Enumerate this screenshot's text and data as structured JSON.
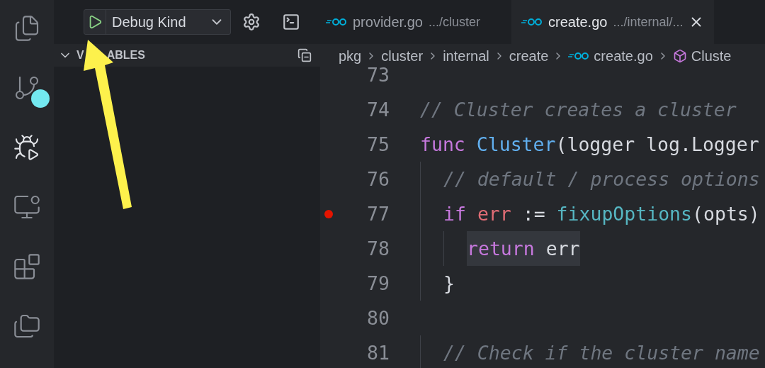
{
  "activity_bar": [
    {
      "kind": "explorer",
      "selected": false,
      "badge": false
    },
    {
      "kind": "source_control",
      "selected": false,
      "badge": true
    },
    {
      "kind": "run_debug",
      "selected": true,
      "badge": false
    },
    {
      "kind": "remote",
      "selected": false,
      "badge": false
    },
    {
      "kind": "extensions",
      "selected": false,
      "badge": false
    },
    {
      "kind": "folders",
      "selected": false,
      "badge": false
    }
  ],
  "debug_toolbar": {
    "configuration": "Debug Kind"
  },
  "tabs": [
    {
      "label": "provider.go",
      "description": ".../cluster",
      "selected": false
    },
    {
      "label": "create.go",
      "description": ".../internal/...",
      "selected": true
    }
  ],
  "sidebar": {
    "section_title": [
      "V",
      "ABLES"
    ],
    "expanded": true
  },
  "breadcrumbs": [
    {
      "text": "pkg",
      "kind": "folder"
    },
    {
      "text": "cluster",
      "kind": "folder"
    },
    {
      "text": "internal",
      "kind": "folder"
    },
    {
      "text": "create",
      "kind": "folder"
    },
    {
      "text": "create.go",
      "kind": "file"
    },
    {
      "text": "Cluste",
      "kind": "symbol"
    }
  ],
  "editor": {
    "lines": [
      {
        "number": "73",
        "breakpoint": false
      },
      {
        "number": "74",
        "breakpoint": false,
        "highlighted": false,
        "tokens": [
          {
            "text": "// Cluster creates a cluster",
            "kind": "comment"
          }
        ]
      },
      {
        "number": "75",
        "breakpoint": false,
        "highlighted": false,
        "tokens": [
          {
            "text": "func ",
            "kind": "keyword"
          },
          {
            "text": "Cluster",
            "kind": "function"
          },
          {
            "text": "(logger log.Logger",
            "kind": "plain"
          }
        ],
        "children": [
          {
            "number": "76",
            "breakpoint": false,
            "highlighted": false,
            "tokens": [
              {
                "text": "// default / process options",
                "kind": "comment"
              }
            ]
          },
          {
            "number": "77",
            "breakpoint": true,
            "highlighted": false,
            "tokens": [
              {
                "text": "if ",
                "kind": "keyword"
              },
              {
                "text": "err",
                "kind": "variable"
              },
              {
                "text": " := ",
                "kind": "plain"
              },
              {
                "text": "fixupOptions",
                "kind": "call"
              },
              {
                "text": "(opts)",
                "kind": "plain"
              }
            ],
            "children": [
              {
                "number": "78",
                "breakpoint": false,
                "highlighted": true,
                "tokens": [
                  {
                    "text": "return ",
                    "kind": "keyword"
                  },
                  {
                    "text": "err",
                    "kind": "plain"
                  }
                ]
              }
            ]
          },
          {
            "number": "79",
            "breakpoint": false,
            "highlighted": false,
            "tokens": [
              {
                "text": "}",
                "kind": "plain"
              }
            ]
          },
          {
            "number": "80",
            "breakpoint": false
          },
          {
            "number": "81",
            "breakpoint": false,
            "highlighted": false,
            "tokens": [
              {
                "text": "// Check if the cluster name",
                "kind": "comment"
              }
            ]
          }
        ]
      }
    ]
  }
}
